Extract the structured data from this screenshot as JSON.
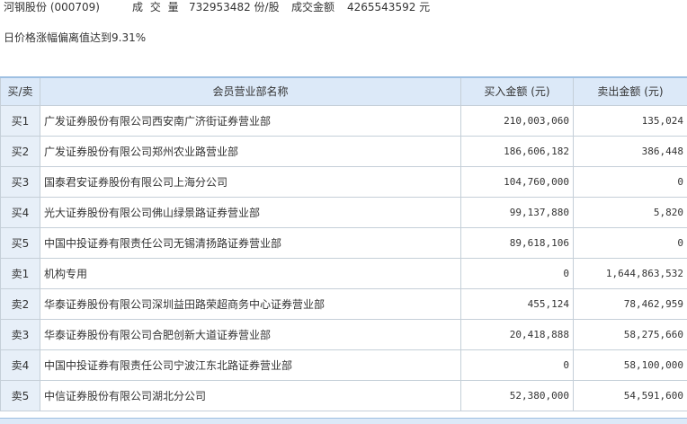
{
  "summary": {
    "stock": "河钢股份 (000709)",
    "volume_label": "成 交 量",
    "volume_value": "732953482 份/股",
    "amount_label": "成交金额",
    "amount_value": "4265543592 元"
  },
  "notice": "日价格涨幅偏离值达到9.31%",
  "table": {
    "headers": [
      "买/卖",
      "会员营业部名称",
      "买入金额 (元)",
      "卖出金额 (元)"
    ],
    "rows": [
      {
        "side": "买1",
        "name": "广发证券股份有限公司西安南广济街证券营业部",
        "buy": "210,003,060",
        "sell": "135,024"
      },
      {
        "side": "买2",
        "name": "广发证券股份有限公司郑州农业路营业部",
        "buy": "186,606,182",
        "sell": "386,448"
      },
      {
        "side": "买3",
        "name": "国泰君安证券股份有限公司上海分公司",
        "buy": "104,760,000",
        "sell": "0"
      },
      {
        "side": "买4",
        "name": "光大证券股份有限公司佛山绿景路证券营业部",
        "buy": "99,137,880",
        "sell": "5,820"
      },
      {
        "side": "买5",
        "name": "中国中投证券有限责任公司无锡清扬路证券营业部",
        "buy": "89,618,106",
        "sell": "0"
      },
      {
        "side": "卖1",
        "name": "机构专用",
        "buy": "0",
        "sell": "1,644,863,532"
      },
      {
        "side": "卖2",
        "name": "华泰证券股份有限公司深圳益田路荣超商务中心证券营业部",
        "buy": "455,124",
        "sell": "78,462,959"
      },
      {
        "side": "卖3",
        "name": "华泰证券股份有限公司合肥创新大道证券营业部",
        "buy": "20,418,888",
        "sell": "58,275,660"
      },
      {
        "side": "卖4",
        "name": "中国中投证券有限责任公司宁波江东北路证券营业部",
        "buy": "0",
        "sell": "58,100,000"
      },
      {
        "side": "卖5",
        "name": "中信证券股份有限公司湖北分公司",
        "buy": "52,380,000",
        "sell": "54,591,600"
      }
    ]
  }
}
